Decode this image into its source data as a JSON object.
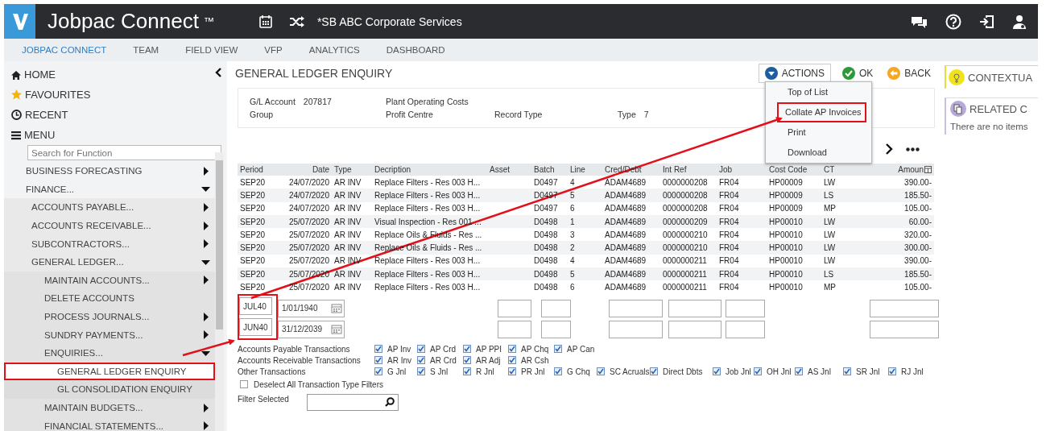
{
  "header": {
    "brand": "Jobpac Connect",
    "trademark": "™",
    "company": "*SB ABC Corporate Services"
  },
  "nav": [
    {
      "label": "JOBPAC CONNECT",
      "selected": true
    },
    {
      "label": "TEAM",
      "selected": false
    },
    {
      "label": "FIELD VIEW",
      "selected": false
    },
    {
      "label": "VFP",
      "selected": false
    },
    {
      "label": "ANALYTICS",
      "selected": false
    },
    {
      "label": "DASHBOARD",
      "selected": false
    }
  ],
  "sidebar": {
    "top_items": [
      {
        "kind": "home",
        "label": "HOME"
      },
      {
        "kind": "favourites",
        "label": "FAVOURITES"
      },
      {
        "kind": "recent",
        "label": "RECENT"
      },
      {
        "kind": "menu",
        "label": "MENU"
      }
    ],
    "search": {
      "placeholder": "Search for Function"
    },
    "tree": [
      {
        "kind": "folder",
        "label": "BUSINESS FORECASTING",
        "expanded": false
      },
      {
        "kind": "folder",
        "label": "FINANCE...",
        "expanded": true,
        "children": [
          {
            "kind": "folder",
            "label": "ACCOUNTS PAYABLE...",
            "expanded": false
          },
          {
            "kind": "folder",
            "label": "ACCOUNTS RECEIVABLE...",
            "expanded": false
          },
          {
            "kind": "folder",
            "label": "SUBCONTRACTORS...",
            "expanded": false
          },
          {
            "kind": "folder",
            "label": "GENERAL LEDGER...",
            "expanded": true,
            "children": [
              {
                "kind": "folder",
                "label": "MAINTAIN ACCOUNTS...",
                "expanded": false
              },
              {
                "kind": "function",
                "label": "DELETE ACCOUNTS",
                "selected": false
              },
              {
                "kind": "folder",
                "label": "PROCESS JOURNALS...",
                "expanded": false
              },
              {
                "kind": "folder",
                "label": "SUNDRY PAYMENTS...",
                "expanded": false
              },
              {
                "kind": "folder",
                "label": "ENQUIRIES...",
                "expanded": true,
                "children": [
                  {
                    "kind": "function",
                    "label": "GENERAL LEDGER ENQUIRY",
                    "selected": true,
                    "highlighted": true
                  },
                  {
                    "kind": "function",
                    "label": "GL CONSOLIDATION ENQUIRY",
                    "selected": false
                  }
                ]
              },
              {
                "kind": "folder",
                "label": "MAINTAIN BUDGETS...",
                "expanded": false
              },
              {
                "kind": "folder",
                "label": "FINANCIAL STATEMENTS...",
                "expanded": false
              }
            ]
          }
        ]
      }
    ]
  },
  "page_title": "GENERAL LEDGER ENQUIRY",
  "toolbar": {
    "actions": "ACTIONS",
    "ok": "OK",
    "back": "BACK"
  },
  "actions_menu": [
    {
      "label": "Top of List",
      "highlighted": false
    },
    {
      "label": "Collate AP Invoices",
      "highlighted": true
    },
    {
      "label": "Print",
      "highlighted": false
    },
    {
      "label": "Download",
      "highlighted": false
    }
  ],
  "account": [
    [
      {
        "label": "G/L Account",
        "value": "207817"
      },
      {
        "label": "Plant Operating Costs"
      }
    ],
    [
      {
        "label": "Group"
      },
      {
        "label": "Profit Centre"
      },
      {
        "label": "Record Type"
      },
      {
        "label": "Type",
        "value": "7"
      }
    ]
  ],
  "table": {
    "columns": [
      "Period",
      "Date",
      "Type",
      "Decription",
      "Asset",
      "Batch",
      "Line",
      "Cred/Debt",
      "Int Ref",
      "Job",
      "Cost Code",
      "CT",
      "Amoun"
    ],
    "rows": [
      [
        "SEP20",
        "24/07/2020",
        "AR INV",
        "Replace Filters - Res 003 H...",
        "",
        "D0497",
        "4",
        "ADAM4689",
        "0000000208",
        "FR04",
        "HP00009",
        "LW",
        "390.00-"
      ],
      [
        "SEP20",
        "24/07/2020",
        "AR INV",
        "Replace Filters - Res 003 H...",
        "",
        "D0497",
        "5",
        "ADAM4689",
        "0000000208",
        "FR04",
        "HP00009",
        "LS",
        "185.50-"
      ],
      [
        "SEP20",
        "24/07/2020",
        "AR INV",
        "Replace Filters - Res 003 H...",
        "",
        "D0497",
        "6",
        "ADAM4689",
        "0000000208",
        "FR04",
        "HP00009",
        "MP",
        "105.00-"
      ],
      [
        "SEP20",
        "25/07/2020",
        "AR INV",
        "Visual Inspection - Res 001 ...",
        "",
        "D0498",
        "1",
        "ADAM4689",
        "0000000209",
        "FR04",
        "HP00010",
        "LW",
        "60.00-"
      ],
      [
        "SEP20",
        "25/07/2020",
        "AR INV",
        "Replace Oils & Fluids - Res ...",
        "",
        "D0498",
        "3",
        "ADAM4689",
        "0000000210",
        "FR04",
        "HP00010",
        "LW",
        "320.00-"
      ],
      [
        "SEP20",
        "25/07/2020",
        "AR INV",
        "Replace Oils & Fluids - Res ...",
        "",
        "D0498",
        "2",
        "ADAM4689",
        "0000000210",
        "FR04",
        "HP00010",
        "LW",
        "300.00-"
      ],
      [
        "SEP20",
        "25/07/2020",
        "AR INV",
        "Replace Filters - Res 003 H...",
        "",
        "D0498",
        "4",
        "ADAM4689",
        "0000000211",
        "FR04",
        "HP00010",
        "LW",
        "390.00-"
      ],
      [
        "SEP20",
        "25/07/2020",
        "AR INV",
        "Replace Filters - Res 003 H...",
        "",
        "D0498",
        "5",
        "ADAM4689",
        "0000000211",
        "FR04",
        "HP00010",
        "LS",
        "185.50-"
      ],
      [
        "SEP20",
        "25/07/2020",
        "AR INV",
        "Replace Filters - Res 003 H...",
        "",
        "D0498",
        "6",
        "ADAM4689",
        "0000000211",
        "FR04",
        "HP00010",
        "MP",
        "105.00-"
      ]
    ]
  },
  "filters": {
    "period_highlighted": true,
    "from": {
      "period": "JUL40",
      "date": "1/01/1940"
    },
    "to": {
      "period": "JUN40",
      "date": "31/12/2039"
    }
  },
  "transaction_groups": [
    {
      "label": "Accounts Payable Transactions",
      "items": [
        {
          "label": "AP Inv",
          "checked": true
        },
        {
          "label": "AP Crd",
          "checked": true
        },
        {
          "label": "AP PPI",
          "checked": true
        },
        {
          "label": "AP Chq",
          "checked": true
        },
        {
          "label": "AP Can",
          "checked": true
        }
      ]
    },
    {
      "label": "Accounts Receivable Transactions",
      "items": [
        {
          "label": "AR Inv",
          "checked": true
        },
        {
          "label": "AR Crd",
          "checked": true
        },
        {
          "label": "AR Adj",
          "checked": true
        },
        {
          "label": "AR Csh",
          "checked": true
        }
      ]
    },
    {
      "label": "Other Transactions",
      "items": [
        {
          "label": "G Jnl",
          "checked": true
        },
        {
          "label": "S Jnl",
          "checked": true
        },
        {
          "label": "R Jnl",
          "checked": true
        },
        {
          "label": "PR Jnl",
          "checked": true
        },
        {
          "label": "G Chq",
          "checked": true
        },
        {
          "label": "SC Acruals",
          "checked": true
        },
        {
          "label": "Direct Dbts",
          "checked": true
        },
        {
          "label": "Job Jnl",
          "checked": true
        },
        {
          "label": "OH Jnl",
          "checked": true
        },
        {
          "label": "AS Jnl",
          "checked": true
        },
        {
          "label": "SR Jnl",
          "checked": true
        },
        {
          "label": "RJ Jnl",
          "checked": true
        }
      ]
    }
  ],
  "deselect_all": {
    "label": "Deselect All Transaction Type Filters",
    "checked": false
  },
  "filter_selected": {
    "label": "Filter Selected"
  },
  "right_panel": {
    "contextual": "CONTEXTUA",
    "related": "RELATED C",
    "related_empty": "There are no items"
  }
}
